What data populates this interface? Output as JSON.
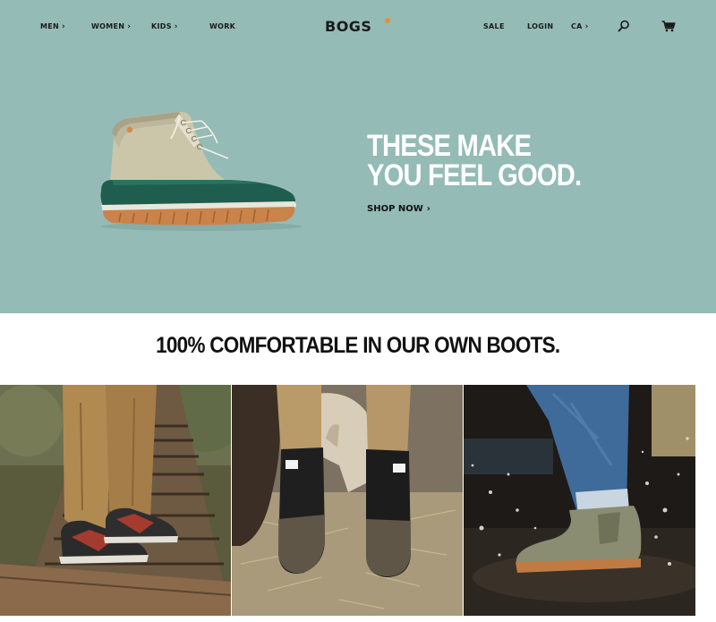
{
  "header": {
    "nav_left": [
      {
        "label": "MEN",
        "chevron": "›"
      },
      {
        "label": "WOMEN",
        "chevron": "›"
      },
      {
        "label": "KIDS",
        "chevron": "›"
      },
      {
        "label": "WORK",
        "chevron": ""
      }
    ],
    "logo": "BOGS",
    "nav_right": [
      {
        "label": "SALE",
        "chevron": ""
      },
      {
        "label": "LOGIN",
        "chevron": ""
      },
      {
        "label": "CA",
        "chevron": "›"
      }
    ],
    "icons": [
      "search-icon",
      "cart-icon"
    ]
  },
  "hero": {
    "headline": "THESE MAKE YOU FEEL GOOD.",
    "cta_label": "SHOP NOW",
    "cta_chevron": "›",
    "background": "#94bbb6",
    "headline_color": "#ffffff"
  },
  "section": {
    "heading": "100% COMFORTABLE IN OUR OWN BOOTS."
  },
  "colors": {
    "logo_dot": "#f08a2c",
    "boot_rubber": "#1f5e4f",
    "boot_sole": "#c9834b",
    "boot_upper": "#c9c4a8"
  }
}
